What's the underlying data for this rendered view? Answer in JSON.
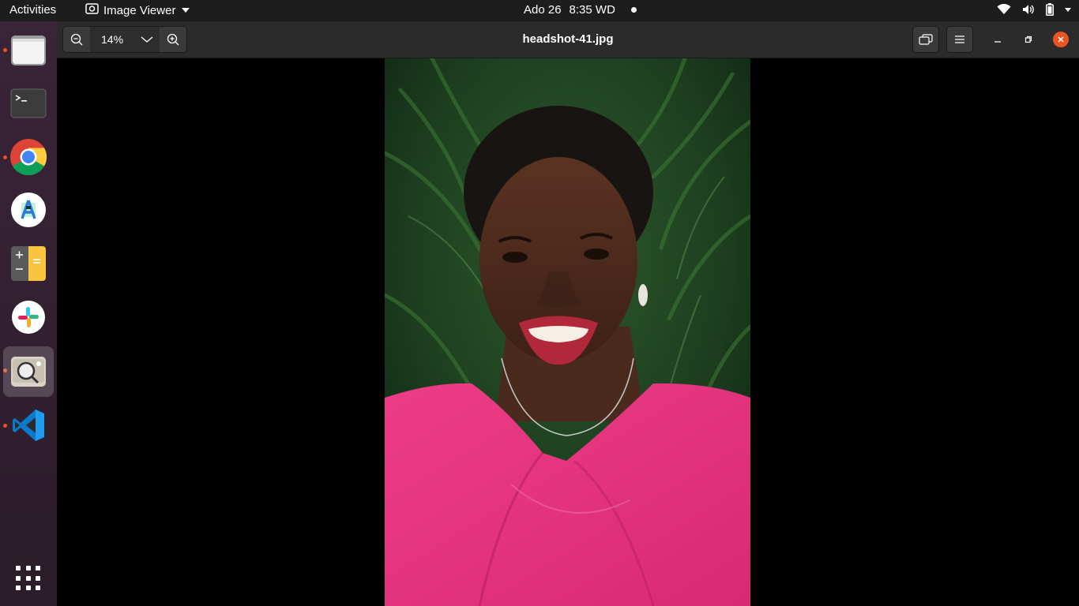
{
  "topbar": {
    "activities": "Activities",
    "app_name": "Image Viewer",
    "date": "Ado 26",
    "time": "8:35 WD",
    "tray_icons": [
      "wifi-icon",
      "volume-icon",
      "battery-icon",
      "system-menu-caret"
    ]
  },
  "dock": {
    "items": [
      {
        "name": "files",
        "icon": "folder-icon",
        "running": true
      },
      {
        "name": "terminal",
        "icon": "terminal-icon",
        "running": false
      },
      {
        "name": "chrome",
        "icon": "chrome-icon",
        "running": true
      },
      {
        "name": "android-studio",
        "icon": "android-studio-icon",
        "running": false
      },
      {
        "name": "calculator",
        "icon": "calculator-icon",
        "running": false
      },
      {
        "name": "slack",
        "icon": "slack-icon",
        "running": false
      },
      {
        "name": "image-viewer",
        "icon": "image-viewer-icon",
        "running": true,
        "active": true
      },
      {
        "name": "vscode",
        "icon": "vscode-icon",
        "running": true
      }
    ],
    "show_apps_icon": "apps-grid-icon"
  },
  "window": {
    "title": "headshot-41.jpg",
    "zoom_value": "14%",
    "zoom_out_icon": "zoom-out-icon",
    "zoom_in_icon": "zoom-in-icon",
    "zoom_menu_icon": "chevron-down-icon",
    "gallery_icon": "gallery-icon",
    "menu_icon": "hamburger-icon"
  },
  "colors": {
    "accent": "#e95420",
    "topbar": "#1d1d1d",
    "headerbar": "#2b2b2b",
    "shirt": "#e8397f",
    "foliage": "#1f4a24"
  }
}
